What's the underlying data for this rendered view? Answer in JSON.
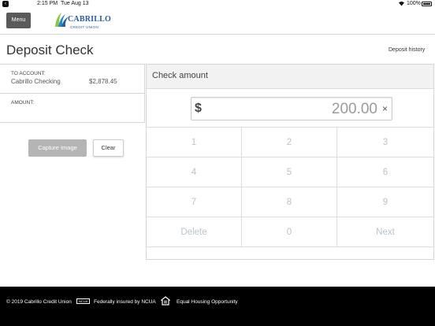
{
  "status_bar": {
    "time": "2:15 PM",
    "date": "Tue Aug 13",
    "battery": "100%",
    "icons": [
      "back-icon",
      "wifi-icon",
      "battery-icon"
    ]
  },
  "header": {
    "menu_label": "Menu",
    "logo_name": "CABRILLO",
    "logo_sub": "CREDIT UNION"
  },
  "page": {
    "title": "Deposit Check",
    "history_link": "Deposit history"
  },
  "account": {
    "to_label": "TO ACCOUNT:",
    "name": "Cabrillo Checking",
    "balance": "$2,878.45",
    "amount_label": "AMOUNT:"
  },
  "actions": {
    "capture_label": "Capture Image",
    "clear_label": "Clear"
  },
  "check_panel": {
    "title": "Check amount",
    "currency_symbol": "$",
    "amount_value": "200.00",
    "clear_glyph": "×"
  },
  "keypad": {
    "keys": [
      "1",
      "2",
      "3",
      "4",
      "5",
      "6",
      "7",
      "8",
      "9",
      "Delete",
      "0",
      "Next"
    ]
  },
  "footer": {
    "copyright": "© 2019 Cabrillo Credit Union",
    "ncua_badge": "NCUA",
    "insured": "Federally insured by NCUA",
    "equal_housing": "Equal Housing Opportunity"
  },
  "colors": {
    "logo_blue": "#2c5aa0",
    "key_text": "#b8c3cc",
    "disabled_button": "#b5b5b5",
    "footer_bg": "#000000"
  }
}
